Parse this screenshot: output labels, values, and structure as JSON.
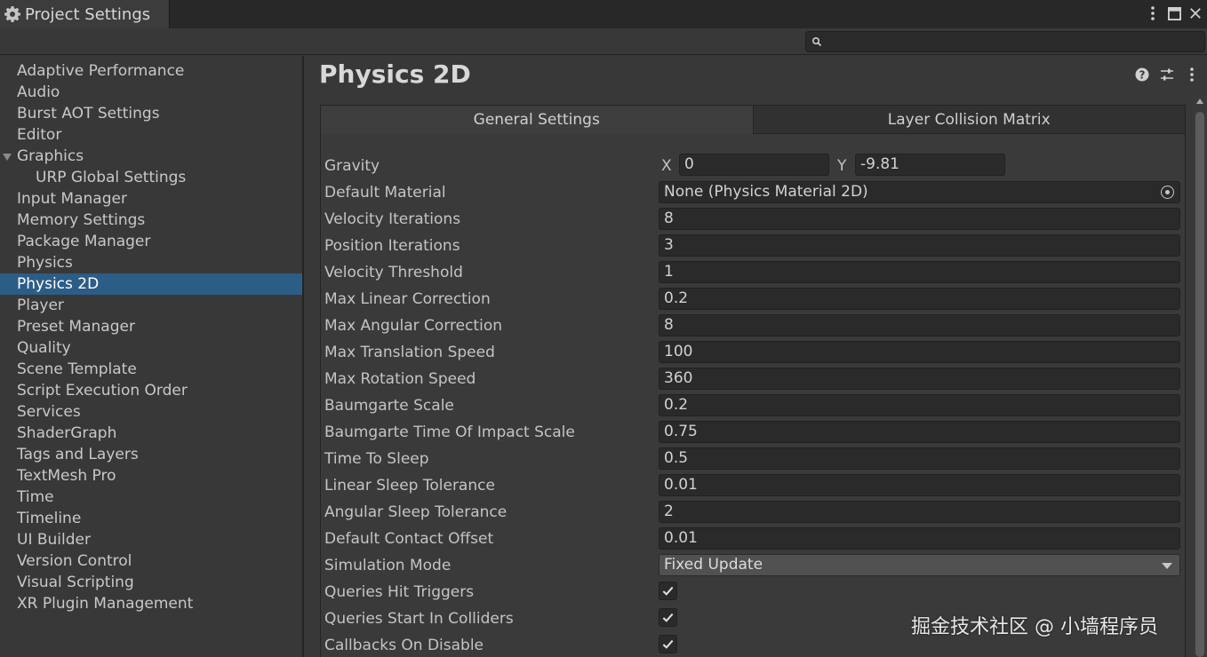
{
  "window": {
    "tab_title": "Project Settings",
    "icons": [
      "gear-icon",
      "kebab-menu-icon",
      "maximize-icon",
      "close-icon"
    ]
  },
  "search": {
    "placeholder": "",
    "value": ""
  },
  "sidebar": {
    "items": [
      {
        "label": "Adaptive Performance"
      },
      {
        "label": "Audio"
      },
      {
        "label": "Burst AOT Settings"
      },
      {
        "label": "Editor"
      },
      {
        "label": "Graphics",
        "expanded": true
      },
      {
        "label": "URP Global Settings",
        "child": true
      },
      {
        "label": "Input Manager"
      },
      {
        "label": "Memory Settings"
      },
      {
        "label": "Package Manager"
      },
      {
        "label": "Physics"
      },
      {
        "label": "Physics 2D",
        "selected": true
      },
      {
        "label": "Player"
      },
      {
        "label": "Preset Manager"
      },
      {
        "label": "Quality"
      },
      {
        "label": "Scene Template"
      },
      {
        "label": "Script Execution Order"
      },
      {
        "label": "Services"
      },
      {
        "label": "ShaderGraph"
      },
      {
        "label": "Tags and Layers"
      },
      {
        "label": "TextMesh Pro"
      },
      {
        "label": "Time"
      },
      {
        "label": "Timeline"
      },
      {
        "label": "UI Builder"
      },
      {
        "label": "Version Control"
      },
      {
        "label": "Visual Scripting"
      },
      {
        "label": "XR Plugin Management"
      }
    ],
    "selected_color": "#2c5d87"
  },
  "main": {
    "title": "Physics 2D",
    "header_icons": [
      "help-icon",
      "preset-sliders-icon",
      "kebab-menu-icon"
    ],
    "tabs": [
      {
        "label": "General Settings",
        "active": true
      },
      {
        "label": "Layer Collision Matrix",
        "active": false
      }
    ],
    "gravity": {
      "label": "Gravity",
      "x_label": "X",
      "x": "0",
      "y_label": "Y",
      "y": "-9.81"
    },
    "default_material": {
      "label": "Default Material",
      "value": "None (Physics Material 2D)"
    },
    "fields": [
      {
        "label": "Velocity Iterations",
        "value": "8"
      },
      {
        "label": "Position Iterations",
        "value": "3"
      },
      {
        "label": "Velocity Threshold",
        "value": "1"
      },
      {
        "label": "Max Linear Correction",
        "value": "0.2"
      },
      {
        "label": "Max Angular Correction",
        "value": "8"
      },
      {
        "label": "Max Translation Speed",
        "value": "100"
      },
      {
        "label": "Max Rotation Speed",
        "value": "360"
      },
      {
        "label": "Baumgarte Scale",
        "value": "0.2"
      },
      {
        "label": "Baumgarte Time Of Impact Scale",
        "value": "0.75"
      },
      {
        "label": "Time To Sleep",
        "value": "0.5"
      },
      {
        "label": "Linear Sleep Tolerance",
        "value": "0.01"
      },
      {
        "label": "Angular Sleep Tolerance",
        "value": "2"
      },
      {
        "label": "Default Contact Offset",
        "value": "0.01"
      }
    ],
    "simulation_mode": {
      "label": "Simulation Mode",
      "value": "Fixed Update"
    },
    "checkboxes": [
      {
        "label": "Queries Hit Triggers",
        "checked": true
      },
      {
        "label": "Queries Start In Colliders",
        "checked": true
      },
      {
        "label": "Callbacks On Disable",
        "checked": true
      }
    ]
  },
  "watermark": "掘金技术社区 @ 小墙程序员"
}
